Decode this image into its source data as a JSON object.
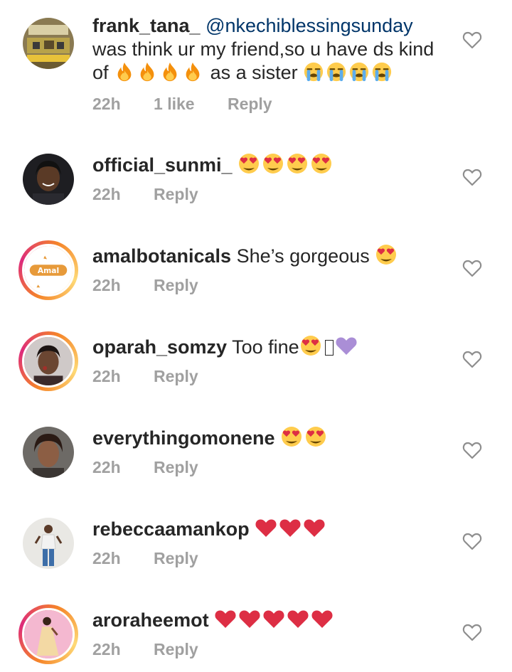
{
  "comments": [
    {
      "username": "frank_tana_",
      "mention": "@nkechiblessingsunday",
      "text_line1": "was think ur my friend,so u have ds kind",
      "text_line2_pre": "of",
      "text_line2_mid": "as a sister",
      "emoji_a": "fire",
      "emoji_b": "loudly-crying-face",
      "time": "22h",
      "likes": "1 like",
      "reply": "Reply"
    },
    {
      "username": "official_sunmi_",
      "text": "",
      "emoji": "heart-eyes",
      "time": "22h",
      "reply": "Reply"
    },
    {
      "username": "amalbotanicals",
      "text": "She’s gorgeous",
      "emoji": "heart-eyes",
      "time": "22h",
      "reply": "Reply",
      "avatar_text": "Amal"
    },
    {
      "username": "oparah_somzy",
      "text": "Too fine",
      "emoji": "heart-eyes",
      "time": "22h",
      "reply": "Reply"
    },
    {
      "username": "everythingomonene",
      "text": "",
      "emoji": "heart-eyes",
      "time": "22h",
      "reply": "Reply"
    },
    {
      "username": "rebeccaamankop",
      "text": "",
      "emoji": "red-heart",
      "time": "22h",
      "reply": "Reply"
    },
    {
      "username": "aroraheemot",
      "text": "",
      "emoji": "red-heart",
      "time": "22h",
      "reply": "Reply"
    }
  ],
  "colors": {
    "text": "#262626",
    "meta": "#a0a0a0",
    "mention": "#003569",
    "story_ring_start": "#f58529",
    "story_ring_end": "#dd2a7b"
  }
}
